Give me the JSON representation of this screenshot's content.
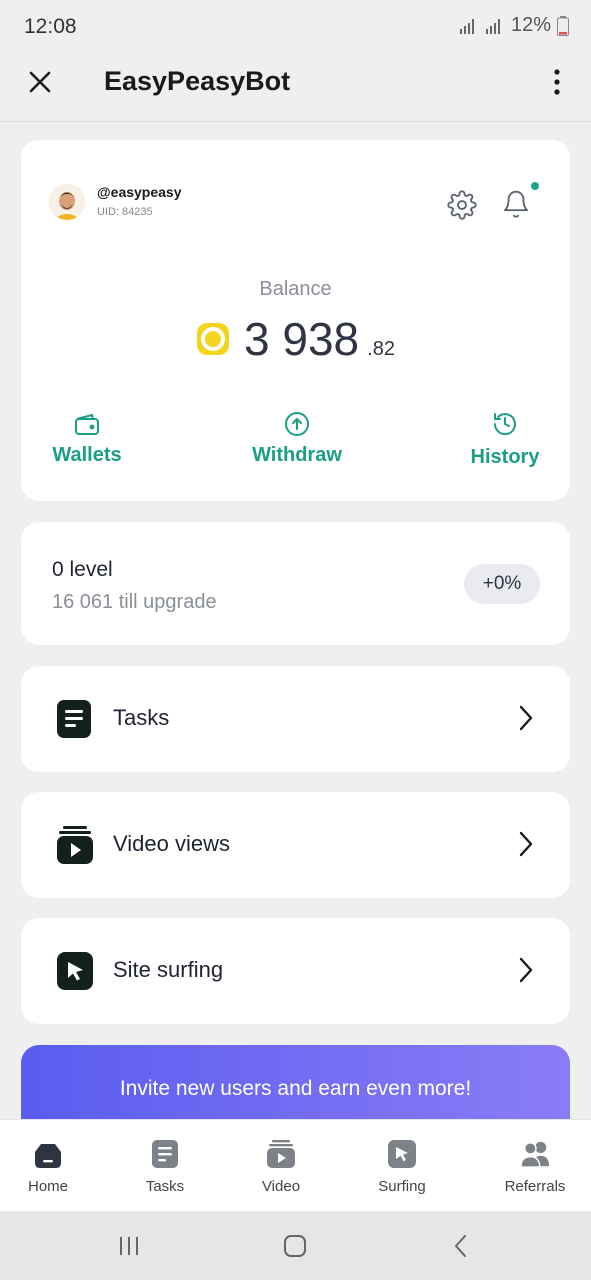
{
  "status_bar": {
    "time": "12:08",
    "battery": "12%"
  },
  "header": {
    "title": "EasyPeasyBot"
  },
  "profile": {
    "username": "@easypeasy",
    "uid": "UID: 84235"
  },
  "balance": {
    "label": "Balance",
    "amount": "3 938",
    "decimals": ".82"
  },
  "actions": [
    {
      "label": "Wallets",
      "icon": "wallet-icon"
    },
    {
      "label": "Withdraw",
      "icon": "arrow-up-circle-icon"
    },
    {
      "label": "History",
      "icon": "history-icon"
    }
  ],
  "level": {
    "title": "0 level",
    "subtitle": "16 061 till upgrade",
    "badge": "+0%"
  },
  "menu": [
    {
      "label": "Tasks",
      "icon": "tasks-icon"
    },
    {
      "label": "Video views",
      "icon": "video-icon"
    },
    {
      "label": "Site surfing",
      "icon": "cursor-icon"
    }
  ],
  "invite": {
    "text": "Invite new users and earn even more!"
  },
  "bottom_nav": [
    {
      "label": "Home",
      "icon": "home-icon"
    },
    {
      "label": "Tasks",
      "icon": "tasks-icon"
    },
    {
      "label": "Video",
      "icon": "video-icon"
    },
    {
      "label": "Surfing",
      "icon": "cursor-icon"
    },
    {
      "label": "Referrals",
      "icon": "users-icon"
    }
  ],
  "colors": {
    "accent": "#1a9e85",
    "coin": "#f3d51f",
    "banner_start": "#5a5cf0",
    "banner_end": "#8a7cf6",
    "notification_dot": "#1fa58a"
  }
}
